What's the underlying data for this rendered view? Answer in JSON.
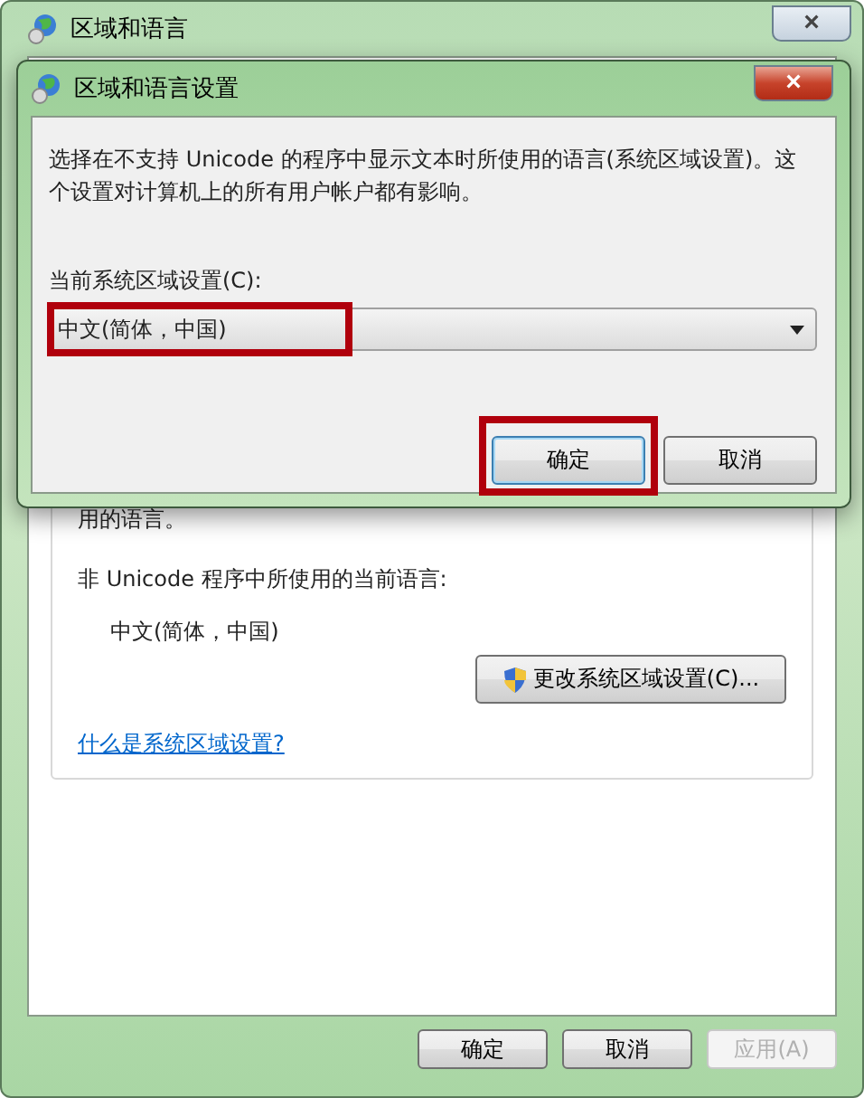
{
  "window": {
    "title": "区域和语言",
    "close": "×"
  },
  "content": {
    "partial_text": "用的语言。",
    "current_label": "非 Unicode 程序中所使用的当前语言:",
    "current_value": "中文(简体，中国)",
    "change_button": "更改系统区域设置(C)...",
    "help_link": "什么是系统区域设置?"
  },
  "buttons": [
    {
      "label": "确定",
      "disabled": false
    },
    {
      "label": "取消",
      "disabled": false
    },
    {
      "label": "应用(A)",
      "disabled": true
    }
  ],
  "dialog": {
    "title": "区域和语言设置",
    "close": "×",
    "description": "选择在不支持 Unicode 的程序中显示文本时所使用的语言(系统区域设置)。这个设置对计算机上的所有用户帐户都有影响。",
    "locale_label": "当前系统区域设置(C):",
    "locale_value": "中文(简体，中国)",
    "locale_highlighted": true,
    "buttons": [
      {
        "label": "确定",
        "default": true,
        "highlighted": true
      },
      {
        "label": "取消",
        "default": false,
        "highlighted": false
      }
    ]
  }
}
